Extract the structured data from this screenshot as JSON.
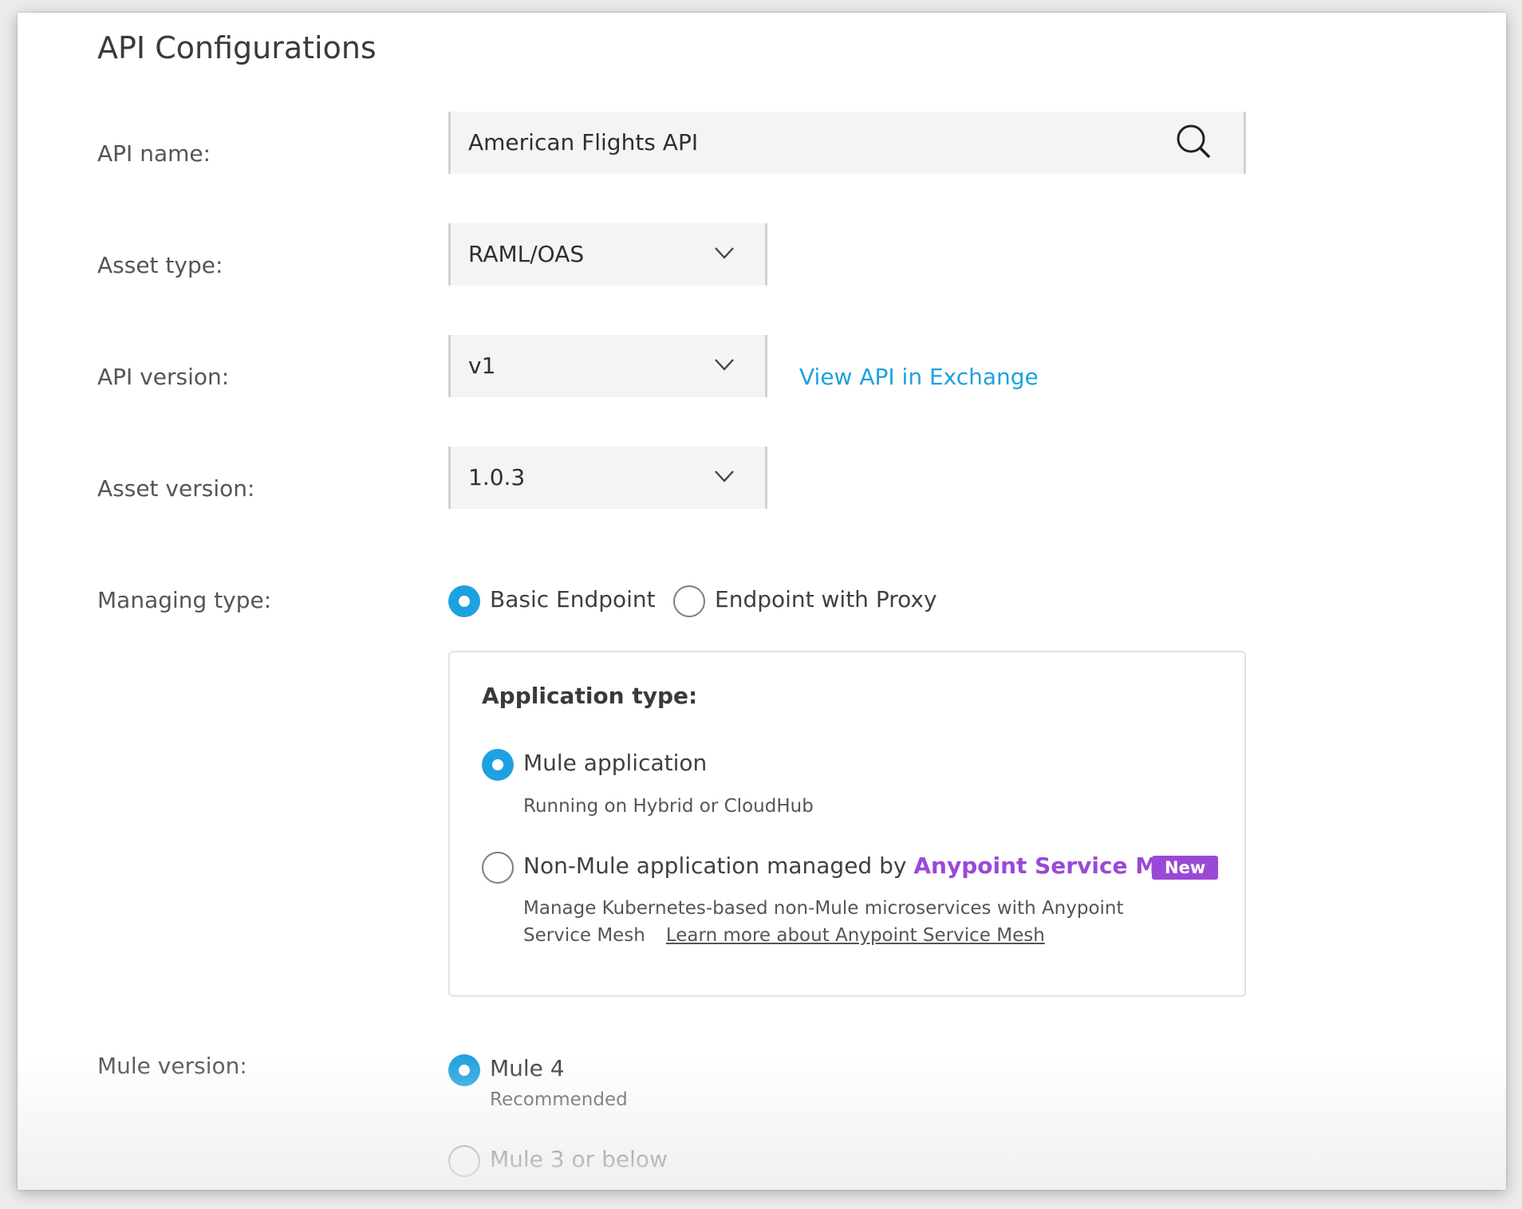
{
  "page": {
    "title": "API Configurations"
  },
  "form": {
    "api_name": {
      "label": "API name:",
      "value": "American Flights API",
      "icon": "search-icon"
    },
    "asset_type": {
      "label": "Asset type:",
      "value": "RAML/OAS",
      "icon": "chevron-down-icon"
    },
    "api_version": {
      "label": "API version:",
      "value": "v1",
      "icon": "chevron-down-icon",
      "link": "View API in Exchange"
    },
    "asset_version": {
      "label": "Asset version:",
      "value": "1.0.3",
      "icon": "chevron-down-icon"
    },
    "managing_type": {
      "label": "Managing type:",
      "options": [
        {
          "label": "Basic Endpoint",
          "selected": true
        },
        {
          "label": "Endpoint with Proxy",
          "selected": false
        }
      ]
    },
    "application_type": {
      "heading": "Application type:",
      "mule": {
        "label": "Mule application",
        "description": "Running on Hybrid or CloudHub",
        "selected": true
      },
      "non_mule": {
        "label_prefix": "Non-Mule application managed by ",
        "brand": "Anypoint Service Mesh",
        "badge": "New",
        "description_line1": "Manage Kubernetes-based non-Mule microservices with Anypoint",
        "description_line2": "Service Mesh",
        "learn_more": "Learn more about Anypoint Service Mesh",
        "selected": false
      }
    },
    "mule_version": {
      "label": "Mule version:",
      "options": [
        {
          "label": "Mule 4",
          "note": "Recommended",
          "selected": true
        },
        {
          "label": "Mule 3 or below",
          "selected": false
        }
      ]
    }
  },
  "colors": {
    "accent": "#1ea1e0",
    "brand_purple": "#9a49d6",
    "field_bg": "#f3f4f5"
  }
}
